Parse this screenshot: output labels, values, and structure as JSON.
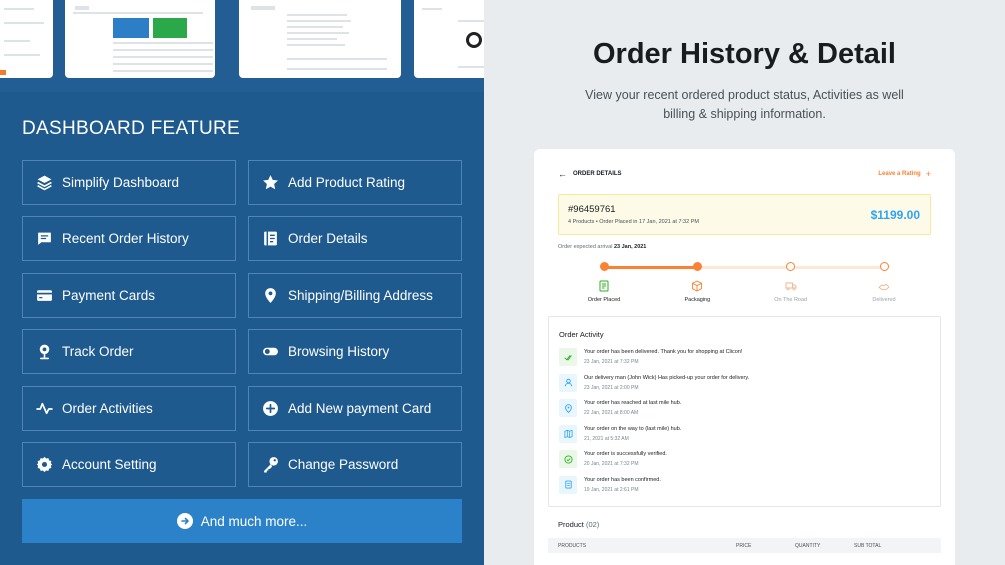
{
  "left": {
    "section_title": "DASHBOARD FEATURE",
    "features": [
      {
        "label": "Simplify Dashboard",
        "icon": "layers-icon"
      },
      {
        "label": "Add Product Rating",
        "icon": "star-icon"
      },
      {
        "label": "Recent Order History",
        "icon": "message-list-icon"
      },
      {
        "label": "Order Details",
        "icon": "notebook-icon"
      },
      {
        "label": "Payment Cards",
        "icon": "credit-card-icon"
      },
      {
        "label": "Shipping/Billing Address",
        "icon": "map-pin-icon"
      },
      {
        "label": "Track Order",
        "icon": "location-icon"
      },
      {
        "label": "Browsing History",
        "icon": "toggle-icon"
      },
      {
        "label": "Order Activities",
        "icon": "activity-icon"
      },
      {
        "label": "Add New payment Card",
        "icon": "plus-circle-icon"
      },
      {
        "label": "Account Setting",
        "icon": "gear-icon"
      },
      {
        "label": "Change Password",
        "icon": "key-icon"
      }
    ],
    "more_label": "And much more..."
  },
  "right": {
    "title": "Order History & Detail",
    "subtitle": "View your recent ordered product status, Activities as well billing & shipping information.",
    "card": {
      "header_label": "ORDER DETAILS",
      "rate_label": "Leave a Rating",
      "order_id": "#96459761",
      "order_meta": "4 Products  •  Order Placed in 17 Jan, 2021 at 7:32 PM",
      "price": "$1199.00",
      "arrival_prefix": "Order expected arrival",
      "arrival_date": "23 Jan, 2021",
      "progress": 0.33,
      "steps": [
        {
          "label": "Order Placed",
          "done": true
        },
        {
          "label": "Packaging",
          "done": true
        },
        {
          "label": "On The Road",
          "done": false
        },
        {
          "label": "Delivered",
          "done": false
        }
      ],
      "activity_title": "Order Activity",
      "activities": [
        {
          "text": "Your order has been delivered. Thank you for shopping at Clicon!",
          "date": "23 Jan, 2021 at 7:32 PM",
          "icon": "double-check-icon",
          "tone": "green"
        },
        {
          "text": "Our delivery man (John Wick) Has picked-up your order for delivery.",
          "date": "23 Jan, 2021 at 2:00 PM",
          "icon": "user-icon",
          "tone": "blue"
        },
        {
          "text": "Your order has reached at last mile hub.",
          "date": "22 Jan, 2021 at 8:00 AM",
          "icon": "map-pin-icon",
          "tone": "blue"
        },
        {
          "text": "Your order on the way to (last mile) hub.",
          "date": "21, 2021 at 5:32 AM",
          "icon": "map-icon",
          "tone": "blue"
        },
        {
          "text": "Your order is successfully verified.",
          "date": "20 Jan, 2021 at 7:32 PM",
          "icon": "check-circle-icon",
          "tone": "green"
        },
        {
          "text": "Your order has been confirmed.",
          "date": "19 Jan, 2021 at 2:61 PM",
          "icon": "notepad-icon",
          "tone": "blue"
        }
      ],
      "product_title": "Product",
      "product_count": "(02)",
      "table_headers": [
        "PRODUCTS",
        "PRICE",
        "QUANTITY",
        "SUB TOTAL"
      ]
    }
  },
  "colors": {
    "left_bg": "#1f5a8f",
    "accent_orange": "#fa8232",
    "accent_blue": "#2da5f3",
    "more_button": "#2b82c9"
  }
}
